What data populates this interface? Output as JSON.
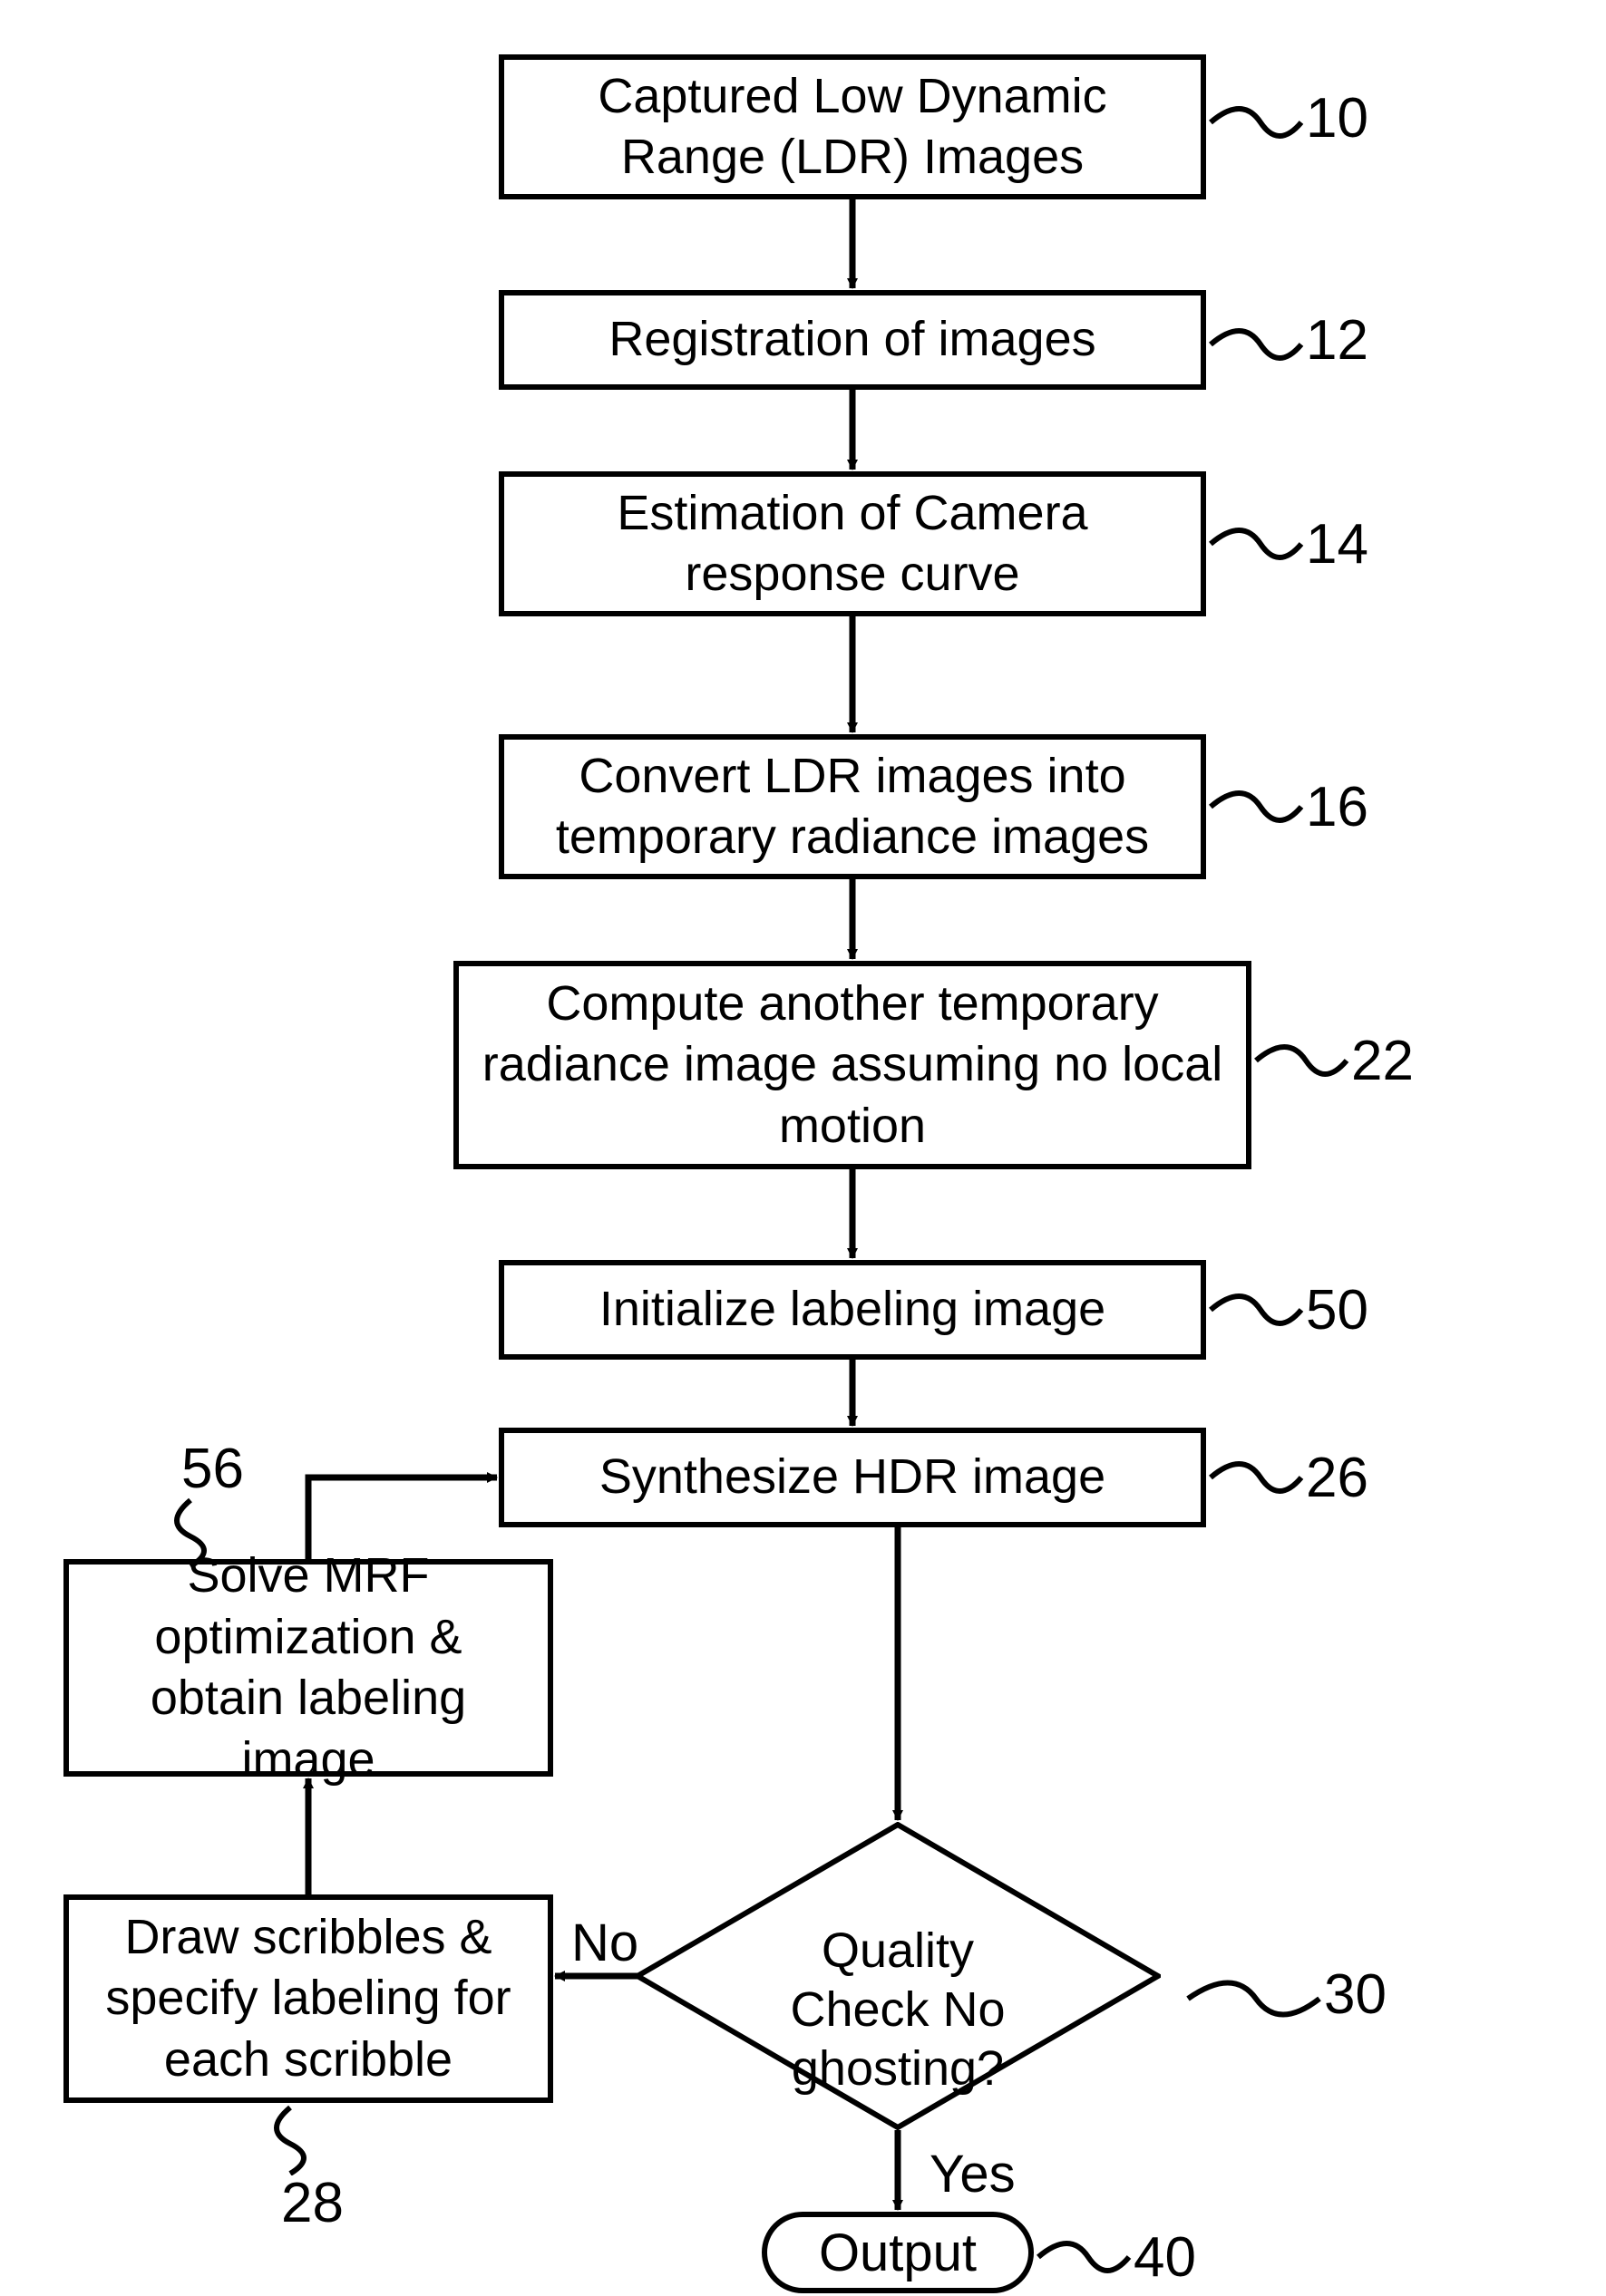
{
  "steps": {
    "s10": "Captured Low Dynamic Range (LDR) Images",
    "s12": "Registration of images",
    "s14": "Estimation of Camera response curve",
    "s16": "Convert LDR images into temporary radiance images",
    "s22": "Compute another temporary radiance image assuming no local motion",
    "s50": "Initialize labeling image",
    "s26": "Synthesize HDR image",
    "s56": "Solve MRF optimization & obtain labeling image",
    "s28": "Draw scribbles & specify labeling for each scribble"
  },
  "labels": {
    "l10": "10",
    "l12": "12",
    "l14": "14",
    "l16": "16",
    "l22": "22",
    "l50": "50",
    "l26": "26",
    "l56": "56",
    "l28": "28",
    "l30": "30",
    "l40": "40"
  },
  "decision": {
    "line1": "Quality",
    "line2": "Check No ghosting?"
  },
  "edges": {
    "no": "No",
    "yes": "Yes"
  },
  "output": "Output"
}
